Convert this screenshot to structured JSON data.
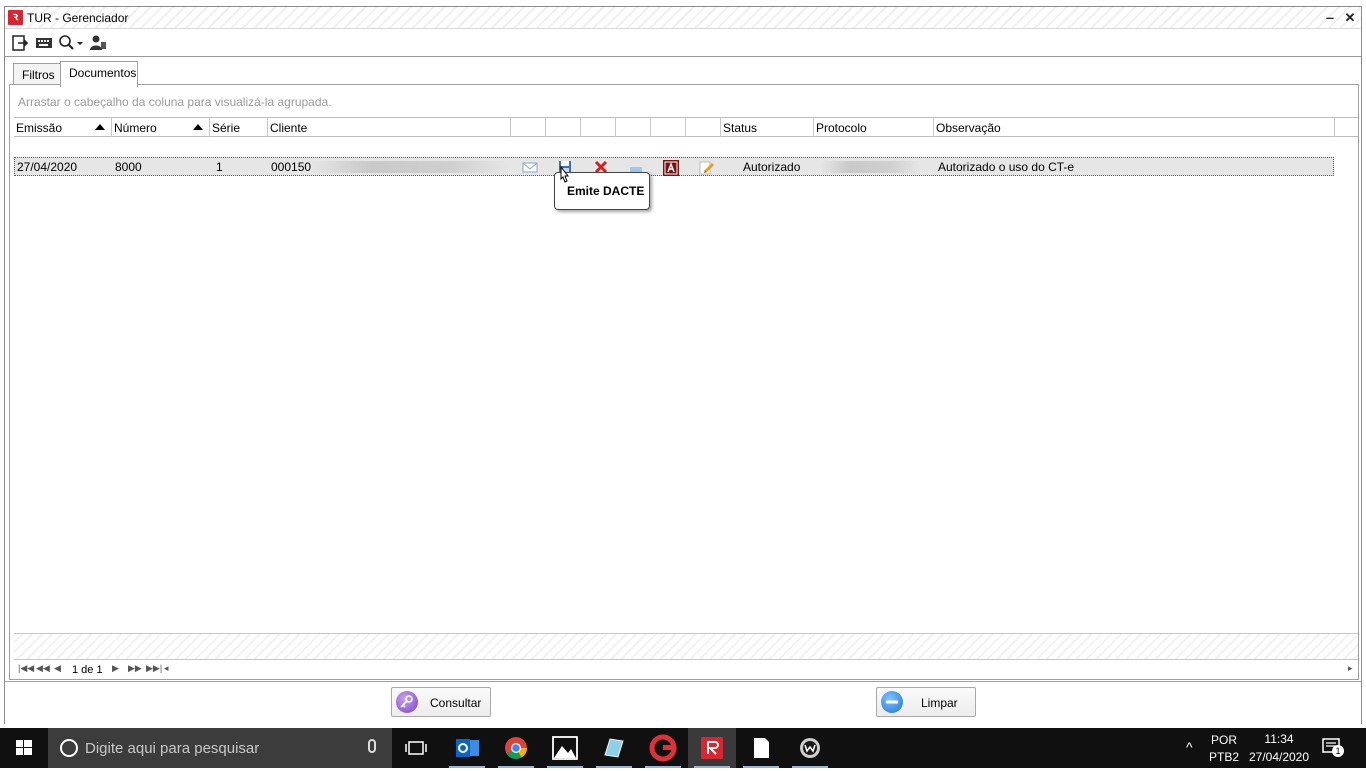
{
  "window": {
    "title": "TUR - Gerenciador",
    "minimize_glyph": "‒",
    "close_glyph": "✕"
  },
  "toolbar": {
    "icons": [
      "exit-icon",
      "keyboard-icon",
      "search-dropdown-icon",
      "user-icon"
    ]
  },
  "tabs": [
    {
      "label": "Filtros",
      "active": false
    },
    {
      "label": "Documentos",
      "active": true
    }
  ],
  "grid": {
    "group_hint": "Arrastar o cabeçalho da coluna para visualizá-la agrupada.",
    "columns": [
      "Emissão",
      "Número",
      "Série",
      "Cliente",
      "",
      "",
      "",
      "",
      "",
      "",
      "Status",
      "Protocolo",
      "Observação"
    ],
    "sorted_columns": [
      "Emissão",
      "Número"
    ],
    "rows": [
      {
        "emissao": "27/04/2020",
        "numero": "8000",
        "serie": "1",
        "cliente": "000150",
        "action_icons": [
          "email-icon",
          "save-icon",
          "cancel-icon",
          "monitor-icon",
          "pdf-icon",
          "edit-icon"
        ],
        "status": "Autorizado",
        "observacao": "Autorizado o uso do CT-e"
      }
    ],
    "tooltip": "Emite DACTE",
    "pager": {
      "text": "1 de 1"
    }
  },
  "actions": {
    "consultar": "Consultar",
    "limpar": "Limpar"
  },
  "taskbar": {
    "search_placeholder": "Digite aqui para pesquisar",
    "lang_top": "POR",
    "lang_bottom": "PTB2",
    "time": "11:34",
    "date": "27/04/2020",
    "notification_count": "1"
  },
  "colors": {
    "app_red": "#d9252f",
    "taskbar": "#101010",
    "search_box": "#3c3c3c",
    "selected_row": "#e6e6e6"
  }
}
